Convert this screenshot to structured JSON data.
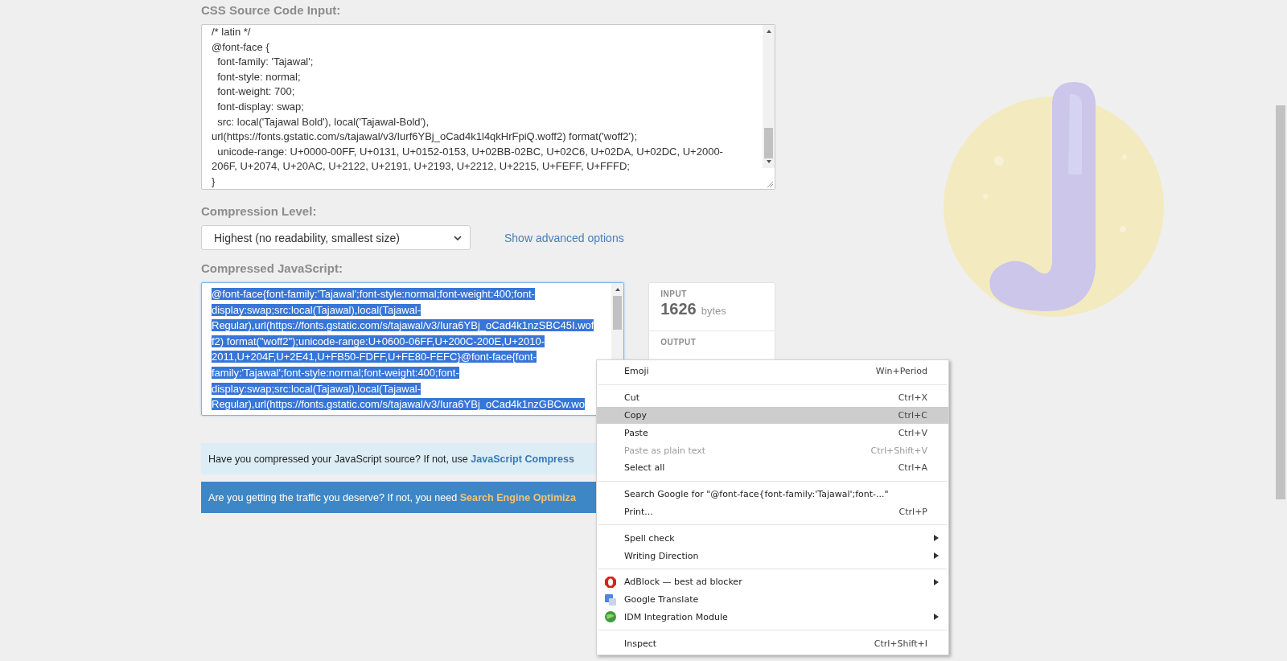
{
  "css_input": {
    "label": "CSS Source Code Input:",
    "lines": [
      "/* latin */",
      "@font-face {",
      "  font-family: 'Tajawal';",
      "  font-style: normal;",
      "  font-weight: 700;",
      "  font-display: swap;",
      "  src: local('Tajawal Bold'), local('Tajawal-Bold'),",
      "url(https://fonts.gstatic.com/s/tajawal/v3/Iurf6YBj_oCad4k1l4qkHrFpiQ.woff2) format('woff2');",
      "  unicode-range: U+0000-00FF, U+0131, U+0152-0153, U+02BB-02BC, U+02C6, U+02DA, U+02DC, U+2000-",
      "206F, U+2074, U+20AC, U+2122, U+2191, U+2193, U+2212, U+2215, U+FEFF, U+FFFD;",
      "}"
    ]
  },
  "compression": {
    "label": "Compression Level:",
    "value": "Highest (no readability, smallest size)",
    "link": "Show advanced options"
  },
  "output": {
    "label": "Compressed JavaScript:",
    "selected": true,
    "lines": [
      "@font-face{font-family:'Tajawal';font-style:normal;font-weight:400;font-",
      "display:swap;src:local(Tajawal),local(Tajawal-",
      "Regular),url(https://fonts.gstatic.com/s/tajawal/v3/Iura6YBj_oCad4k1nzSBC45I.wof",
      "f2) format(\"woff2\");unicode-range:U+0600-06FF,U+200C-200E,U+2010-",
      "2011,U+204F,U+2E41,U+FB50-FDFF,U+FE80-FEFC}@font-face{font-",
      "family:'Tajawal';font-style:normal;font-weight:400;font-",
      "display:swap;src:local(Tajawal),local(Tajawal-",
      "Regular),url(https://fonts.gstatic.com/s/tajawal/v3/Iura6YBj_oCad4k1nzGBCw.wo"
    ]
  },
  "stats": [
    {
      "label": "INPUT",
      "value": "1626",
      "unit": "bytes"
    },
    {
      "label": "OUTPUT"
    }
  ],
  "banners": [
    {
      "kind": "light",
      "text": "Have you compressed your JavaScript source? If not, use ",
      "link": "JavaScript Compress"
    },
    {
      "kind": "dark",
      "text": "Are you getting the traffic you deserve? If not, you need ",
      "link": "Search Engine Optimiza"
    }
  ],
  "context_menu": [
    {
      "kind": "item",
      "label": "Emoji",
      "shortcut": "Win+Period",
      "disabled": false,
      "selected": false,
      "submenu": false
    },
    {
      "kind": "separator"
    },
    {
      "kind": "item",
      "label": "Cut",
      "shortcut": "Ctrl+X",
      "disabled": false,
      "selected": false,
      "submenu": false
    },
    {
      "kind": "item",
      "label": "Copy",
      "shortcut": "Ctrl+C",
      "disabled": false,
      "selected": true,
      "submenu": false
    },
    {
      "kind": "item",
      "label": "Paste",
      "shortcut": "Ctrl+V",
      "disabled": false,
      "selected": false,
      "submenu": false
    },
    {
      "kind": "item",
      "label": "Paste as plain text",
      "shortcut": "Ctrl+Shift+V",
      "disabled": true,
      "selected": false,
      "submenu": false
    },
    {
      "kind": "item",
      "label": "Select all",
      "shortcut": "Ctrl+A",
      "disabled": false,
      "selected": false,
      "submenu": false
    },
    {
      "kind": "separator"
    },
    {
      "kind": "item",
      "label": "Search Google for \"@font-face{font-family:'Tajawal';font-...\"",
      "disabled": false,
      "selected": false,
      "submenu": false
    },
    {
      "kind": "item",
      "label": "Print...",
      "shortcut": "Ctrl+P",
      "disabled": false,
      "selected": false,
      "submenu": false
    },
    {
      "kind": "separator"
    },
    {
      "kind": "item",
      "label": "Spell check",
      "disabled": false,
      "selected": false,
      "submenu": true
    },
    {
      "kind": "item",
      "label": "Writing Direction",
      "disabled": false,
      "selected": false,
      "submenu": true
    },
    {
      "kind": "separator"
    },
    {
      "kind": "extension",
      "label": "AdBlock — best ad blocker",
      "disabled": false,
      "selected": false,
      "submenu": true
    },
    {
      "kind": "extension",
      "label": "Google Translate",
      "disabled": false,
      "selected": false,
      "submenu": false
    },
    {
      "kind": "extension",
      "label": "IDM Integration Module",
      "disabled": false,
      "selected": false,
      "submenu": true
    },
    {
      "kind": "separator"
    },
    {
      "kind": "item",
      "label": "Inspect",
      "shortcut": "Ctrl+Shift+I",
      "disabled": false,
      "selected": false,
      "submenu": false
    }
  ]
}
